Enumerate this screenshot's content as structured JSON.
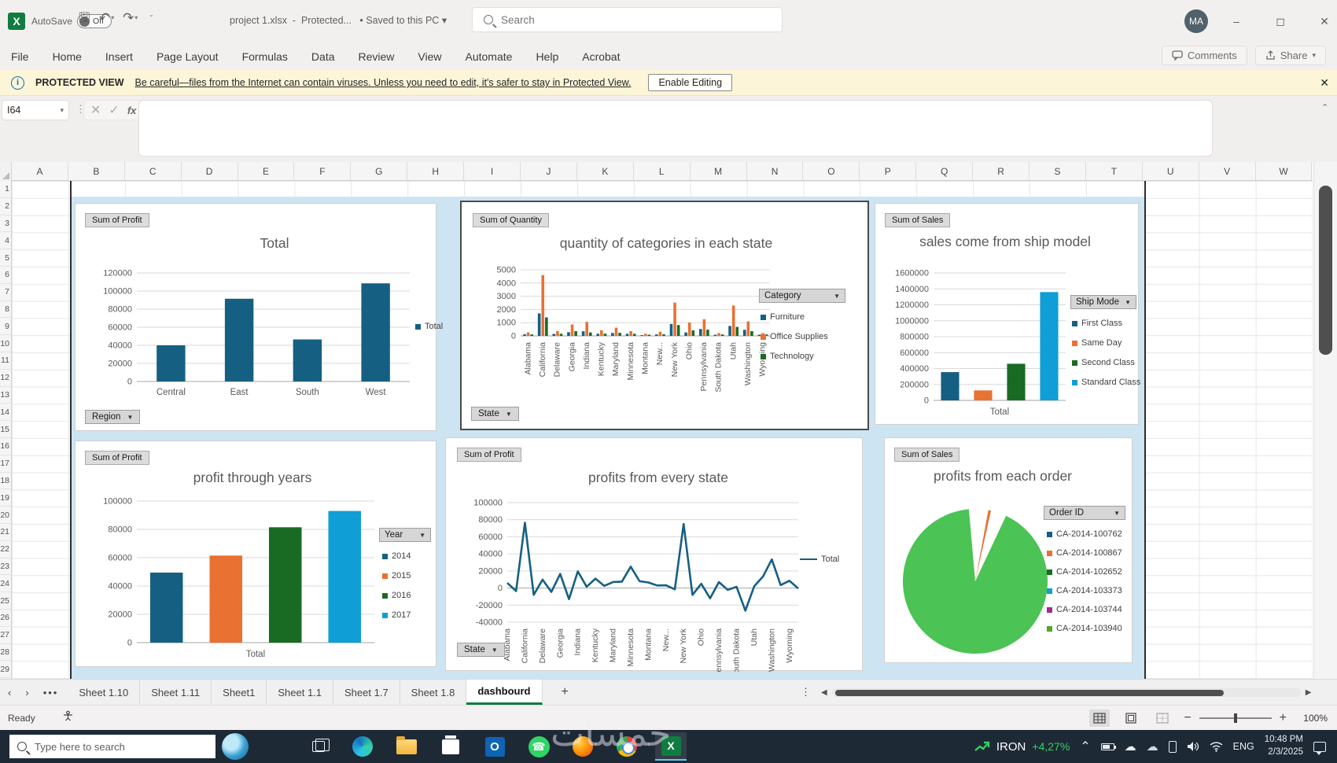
{
  "window": {
    "autosave_label": "AutoSave",
    "autosave_state": "Off",
    "doc_title": "project 1.xlsx",
    "doc_status": "Protected...",
    "saved_status": "Saved to this PC",
    "search_placeholder": "Search",
    "avatar_initials": "MA"
  },
  "menu": {
    "items": [
      "File",
      "Home",
      "Insert",
      "Page Layout",
      "Formulas",
      "Data",
      "Review",
      "View",
      "Automate",
      "Help",
      "Acrobat"
    ],
    "comments_label": "Comments",
    "share_label": "Share"
  },
  "banner": {
    "title": "PROTECTED VIEW",
    "message": "Be careful—files from the Internet can contain viruses. Unless you need to edit, it's safer to stay in Protected View.",
    "button_label": "Enable Editing"
  },
  "formula_bar": {
    "name_box": "I64",
    "fx_label": "fx"
  },
  "grid": {
    "columns": [
      "A",
      "B",
      "C",
      "D",
      "E",
      "F",
      "G",
      "H",
      "I",
      "J",
      "K",
      "L",
      "M",
      "N",
      "O",
      "P",
      "Q",
      "R",
      "S",
      "T",
      "U",
      "V",
      "W"
    ],
    "row_count": 29
  },
  "sheet_tabs": {
    "tabs": [
      "Sheet 1.10",
      "Sheet 1.11",
      "Sheet1",
      "Sheet 1.1",
      "Sheet 1.7",
      "Sheet 1.8",
      "dashbourd"
    ],
    "active": "dashbourd",
    "add_label": "+"
  },
  "status_bar": {
    "mode": "Ready",
    "zoom": "100%"
  },
  "taskbar": {
    "search_placeholder": "Type here to search",
    "stock_ticker": "IRON",
    "stock_change": "+4,27%",
    "language": "ENG",
    "time": "10:48 PM",
    "date": "2/3/2025"
  },
  "watermark": {
    "text": "خمسات"
  },
  "chart_data": [
    {
      "id": "profit-by-region",
      "type": "bar",
      "field_button": "Sum of Profit",
      "title": "Total",
      "slicer": "Region",
      "legend": [
        {
          "label": "Total",
          "color": "#156082"
        }
      ],
      "categories": [
        "Central",
        "East",
        "South",
        "West"
      ],
      "values": [
        40000,
        91500,
        46500,
        108500
      ],
      "bar_color": "#156082",
      "ylim": [
        0,
        120000
      ],
      "ystep": 20000
    },
    {
      "id": "quantity-by-category-state",
      "type": "grouped-bar",
      "field_button": "Sum of Quantity",
      "title": "quantity of categories in each state",
      "slicer": "State",
      "legend_title": "Category",
      "categories": [
        "Alabama",
        "California",
        "Delaware",
        "Georgia",
        "Indiana",
        "Kentucky",
        "Maryland",
        "Minnesota",
        "Montana",
        "New...",
        "New York",
        "Ohio",
        "Pennsylvania",
        "South Dakota",
        "Utah",
        "Washington",
        "Wyoming"
      ],
      "series": [
        {
          "name": "Furniture",
          "color": "#156082",
          "values": [
            120,
            1700,
            150,
            280,
            350,
            160,
            220,
            160,
            60,
            110,
            900,
            260,
            520,
            90,
            750,
            460,
            90
          ]
        },
        {
          "name": "Office Supplies",
          "color": "#E97132",
          "values": [
            260,
            4600,
            360,
            860,
            1060,
            420,
            620,
            360,
            160,
            310,
            2520,
            1010,
            1260,
            210,
            2300,
            1100,
            210
          ]
        },
        {
          "name": "Technology",
          "color": "#196B24",
          "values": [
            110,
            1400,
            160,
            360,
            260,
            170,
            230,
            160,
            90,
            120,
            820,
            420,
            470,
            110,
            680,
            360,
            110
          ]
        }
      ],
      "ylim": [
        0,
        5000
      ],
      "ystep": 1000
    },
    {
      "id": "sales-by-ship-mode",
      "type": "bar",
      "field_button": "Sum of Sales",
      "title": "sales come from ship model",
      "legend_title": "Ship Mode",
      "xlabel": "Total",
      "legend": [
        {
          "label": "First Class",
          "color": "#156082"
        },
        {
          "label": "Same Day",
          "color": "#E97132"
        },
        {
          "label": "Second Class",
          "color": "#196B24"
        },
        {
          "label": "Standard Class",
          "color": "#0F9ED5"
        }
      ],
      "values": [
        355000,
        125000,
        460000,
        1360000
      ],
      "ylim": [
        0,
        1600000
      ],
      "ystep": 200000
    },
    {
      "id": "profit-by-year",
      "type": "bar",
      "field_button": "Sum of Profit",
      "title": "profit through years",
      "legend_title": "Year",
      "xlabel": "Total",
      "legend": [
        {
          "label": "2014",
          "color": "#156082"
        },
        {
          "label": "2015",
          "color": "#E97132"
        },
        {
          "label": "2016",
          "color": "#196B24"
        },
        {
          "label": "2017",
          "color": "#0F9ED5"
        }
      ],
      "values": [
        49500,
        61500,
        81500,
        93000
      ],
      "ylim": [
        0,
        100000
      ],
      "ystep": 20000
    },
    {
      "id": "profit-by-state",
      "type": "line",
      "field_button": "Sum of Profit",
      "title": "profits from every state",
      "slicer": "State",
      "legend": [
        {
          "label": "Total",
          "color": "#156082"
        }
      ],
      "labels": [
        "Alabama",
        "California",
        "Delaware",
        "Georgia",
        "Indiana",
        "Kentucky",
        "Maryland",
        "Minnesota",
        "Montana",
        "New...",
        "New York",
        "Ohio",
        "Pennsylvania",
        "South Dakota",
        "Utah",
        "Washington",
        "Wyoming"
      ],
      "values": [
        6000,
        -3500,
        76500,
        -8000,
        9800,
        -4500,
        16500,
        -13000,
        19500,
        1500,
        11000,
        2500,
        7000,
        7500,
        25000,
        8000,
        6500,
        3000,
        3200,
        -1500,
        75000,
        -8000,
        5000,
        -12000,
        7000,
        -2200,
        1500,
        -26500,
        2000,
        13500,
        33500,
        3500,
        8500,
        -500
      ],
      "line_color": "#156082",
      "ylim": [
        -40000,
        100000
      ],
      "ystep": 20000
    },
    {
      "id": "sales-by-order",
      "type": "pie",
      "field_button": "Sum of Sales",
      "title": "profits from each order",
      "legend_title": "Order ID",
      "legend": [
        {
          "label": "CA-2014-100762",
          "color": "#156082"
        },
        {
          "label": "CA-2014-100867",
          "color": "#E97132"
        },
        {
          "label": "CA-2014-102652",
          "color": "#196B24"
        },
        {
          "label": "CA-2014-103373",
          "color": "#0F9ED5"
        },
        {
          "label": "CA-2014-103744",
          "color": "#A02B93"
        },
        {
          "label": "CA-2014-103940",
          "color": "#4EA72E"
        }
      ],
      "slices": [
        {
          "label": "",
          "pct": 2.9,
          "color": null
        },
        {
          "label": "CA-2014-100867",
          "pct": 0.6,
          "color": "#E97132"
        },
        {
          "label": "",
          "pct": 3.5,
          "color": null
        },
        {
          "label": "CA-2014-103940",
          "pct": 91.6,
          "color": "#4CC355"
        },
        {
          "label": "",
          "pct": 1.4,
          "color": null
        }
      ]
    }
  ]
}
